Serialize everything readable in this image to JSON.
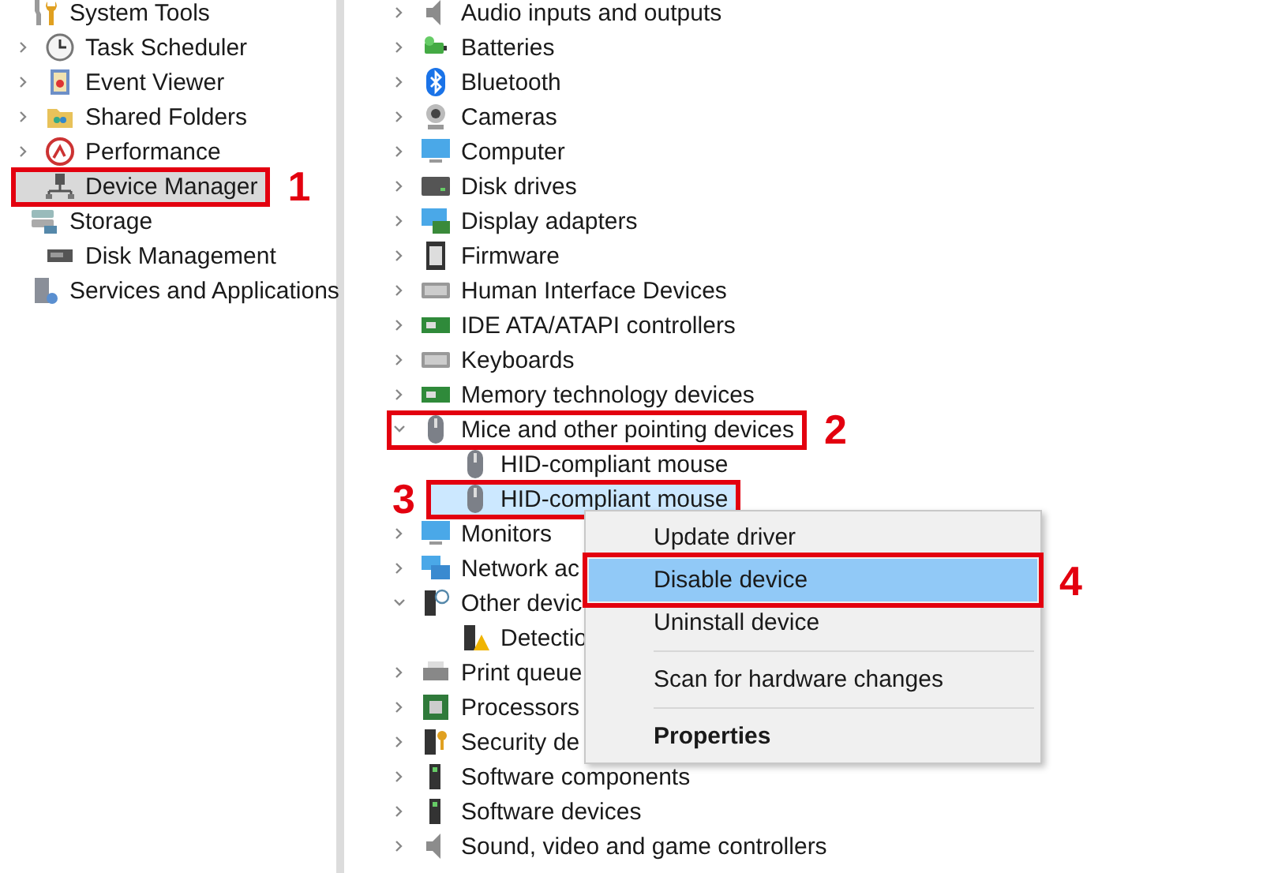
{
  "nav": [
    {
      "label": "System Tools",
      "selected": false,
      "children": [
        {
          "label": "Task Scheduler",
          "expanded": false,
          "selected": false
        },
        {
          "label": "Event Viewer",
          "expanded": false,
          "selected": false
        },
        {
          "label": "Shared Folders",
          "expanded": false,
          "selected": false
        },
        {
          "label": "Performance",
          "expanded": false,
          "selected": false
        },
        {
          "label": "Device Manager",
          "selected": true,
          "callout": {
            "number": "1"
          }
        }
      ]
    },
    {
      "label": "Storage",
      "selected": false,
      "children": [
        {
          "label": "Disk Management",
          "selected": false
        }
      ]
    },
    {
      "label": "Services and Applications",
      "selected": false
    }
  ],
  "devices": [
    {
      "label": "Audio inputs and outputs",
      "expanded": false,
      "selected": false
    },
    {
      "label": "Batteries",
      "expanded": false,
      "selected": false
    },
    {
      "label": "Bluetooth",
      "expanded": false,
      "selected": false
    },
    {
      "label": "Cameras",
      "expanded": false,
      "selected": false
    },
    {
      "label": "Computer",
      "expanded": false,
      "selected": false
    },
    {
      "label": "Disk drives",
      "expanded": false,
      "selected": false
    },
    {
      "label": "Display adapters",
      "expanded": false,
      "selected": false
    },
    {
      "label": "Firmware",
      "expanded": false,
      "selected": false
    },
    {
      "label": "Human Interface Devices",
      "expanded": false,
      "selected": false
    },
    {
      "label": "IDE ATA/ATAPI controllers",
      "expanded": false,
      "selected": false
    },
    {
      "label": "Keyboards",
      "expanded": false,
      "selected": false
    },
    {
      "label": "Memory technology devices",
      "expanded": false,
      "selected": false
    },
    {
      "label": "Mice and other pointing devices",
      "expanded": true,
      "selected": false,
      "callout": {
        "number": "2"
      },
      "children": [
        {
          "label": "HID-compliant mouse",
          "selected": false
        },
        {
          "label": "HID-compliant mouse",
          "selected": true,
          "callout": {
            "number": "3"
          }
        }
      ]
    },
    {
      "label": "Monitors",
      "expanded": false,
      "selected": false
    },
    {
      "label": "Network ac",
      "expanded": false,
      "selected": false
    },
    {
      "label": "Other devic",
      "expanded": true,
      "selected": false,
      "children": [
        {
          "label": "Detectio",
          "selected": false
        }
      ]
    },
    {
      "label": "Print queue",
      "expanded": false,
      "selected": false
    },
    {
      "label": "Processors",
      "expanded": false,
      "selected": false
    },
    {
      "label": "Security de",
      "expanded": false,
      "selected": false
    },
    {
      "label": "Software components",
      "expanded": false,
      "selected": false
    },
    {
      "label": "Software devices",
      "expanded": false,
      "selected": false
    },
    {
      "label": "Sound, video and game controllers",
      "expanded": false,
      "selected": false
    }
  ],
  "context_menu": [
    {
      "kind": "item",
      "label": "Update driver",
      "selected": false,
      "default": false
    },
    {
      "kind": "item",
      "label": "Disable device",
      "selected": true,
      "default": false,
      "callout": {
        "number": "4"
      }
    },
    {
      "kind": "item",
      "label": "Uninstall device",
      "selected": false,
      "default": false
    },
    {
      "kind": "separator"
    },
    {
      "kind": "item",
      "label": "Scan for hardware changes",
      "selected": false,
      "default": false
    },
    {
      "kind": "separator"
    },
    {
      "kind": "item",
      "label": "Properties",
      "selected": false,
      "default": true
    }
  ]
}
